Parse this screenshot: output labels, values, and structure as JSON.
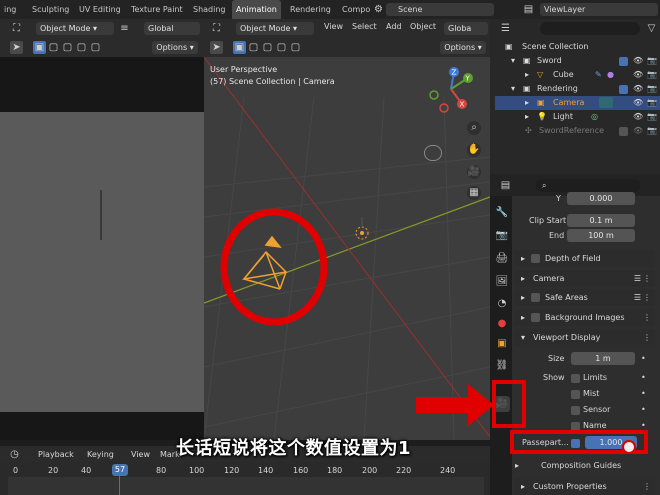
{
  "workspace_tabs": [
    "ing",
    "Sculpting",
    "UV Editing",
    "Texture Paint",
    "Shading",
    "Animation",
    "Rendering",
    "Compo"
  ],
  "active_tab": "Animation",
  "scene": {
    "label": "Scene"
  },
  "view_layer": {
    "label": "ViewLayer"
  },
  "left_editor": {
    "mode": "Object Mode",
    "orientation": "Global",
    "options": "Options"
  },
  "viewport": {
    "mode": "Object Mode",
    "menus": [
      "View",
      "Select",
      "Add",
      "Object"
    ],
    "orientation_short": "Globa",
    "options": "Options",
    "overlay_title": "User Perspective",
    "overlay_subtitle": "(57) Scene Collection | Camera",
    "gizmo_labels": {
      "z": "Z",
      "y": "Y",
      "x": "X"
    }
  },
  "outliner": {
    "root": "Scene Collection",
    "items": [
      {
        "name": "Sword",
        "level": 0,
        "type": "collection"
      },
      {
        "name": "Cube",
        "level": 1,
        "type": "mesh"
      },
      {
        "name": "Rendering",
        "level": 0,
        "type": "collection"
      },
      {
        "name": "Camera",
        "level": 1,
        "type": "camera",
        "selected": true
      },
      {
        "name": "Light",
        "level": 1,
        "type": "light"
      },
      {
        "name": "SwordReference",
        "level": 0,
        "type": "empty",
        "dim": true
      }
    ]
  },
  "properties": {
    "y_label": "Y",
    "y_value": "0.000",
    "clip_start_label": "Clip Start",
    "clip_start_value": "0.1 m",
    "end_label": "End",
    "end_value": "100 m",
    "sections": [
      "Depth of Field",
      "Camera",
      "Safe Areas",
      "Background Images"
    ],
    "viewport_display": {
      "title": "Viewport Display",
      "size_label": "Size",
      "size_value": "1 m",
      "show_label": "Show",
      "show_options": [
        "Limits",
        "Mist",
        "Sensor",
        "Name"
      ]
    },
    "passepartout_label": "Passepart...",
    "passepartout_value": "1.000",
    "composition_guides": "Composition Guides",
    "custom_properties": "Custom Properties"
  },
  "timeline": {
    "menus": [
      "Playback",
      "Keying",
      "View",
      "Mark"
    ],
    "ticks": [
      "0",
      "20",
      "40",
      "57",
      "80",
      "100",
      "120",
      "140",
      "160",
      "180",
      "200",
      "220",
      "240"
    ],
    "current_frame": "57"
  },
  "subtitle": "长话短说将这个数值设置为1",
  "colors": {
    "accent_blue": "#4772b3",
    "annotation_red": "#e00000",
    "camera_orange": "#f0a030"
  }
}
